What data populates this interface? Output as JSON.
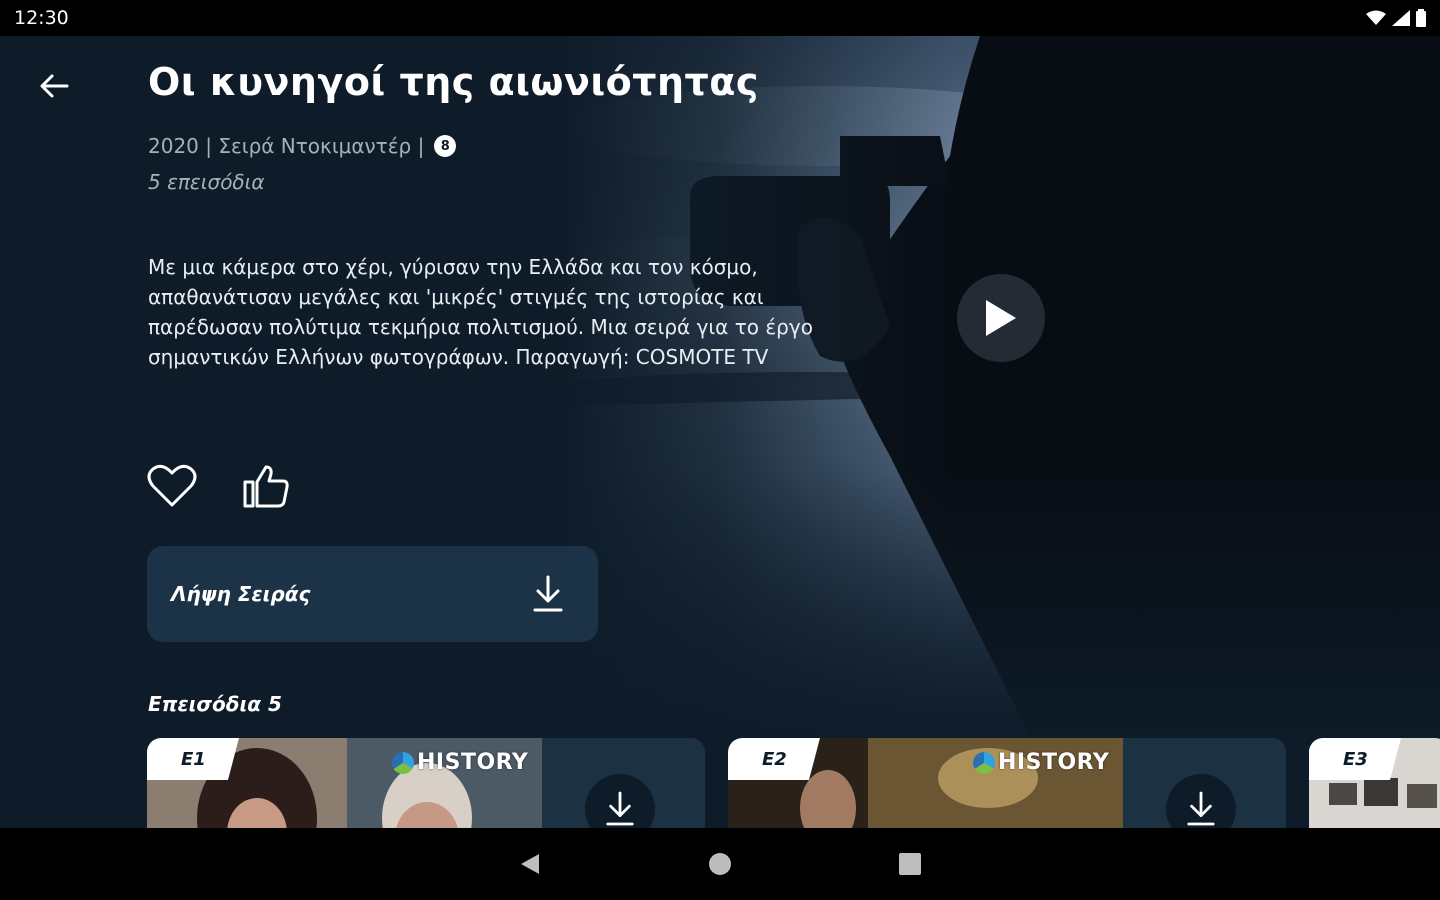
{
  "status_bar": {
    "time": "12:30",
    "icons": [
      "wifi-icon",
      "signal-icon",
      "battery-icon"
    ]
  },
  "header": {
    "back_icon": "arrow-left-icon",
    "title": "Οι κυνηγοί της αιωνιότητας"
  },
  "details": {
    "meta": "2020 | Σειρά Ντοκιμαντέρ |",
    "rating": "8",
    "episodes_count": "5 επεισόδια",
    "description": "Με μια κάμερα στο χέρι, γύρισαν την Ελλάδα και τον κόσμο, απαθανάτισαν μεγάλες και 'μικρές' στιγμές της ιστορίας και παρέδωσαν πολύτιμα τεκμήρια πολιτισμού. Μια σειρά για το έργο σημαντικών Ελλήνων φωτογράφων. Παραγωγή: COSMOTE TV"
  },
  "actions": {
    "favorite_icon": "heart-outline-icon",
    "like_icon": "thumbs-up-icon",
    "download_series_label": "Λήψη Σειράς",
    "download_icon": "download-icon"
  },
  "hero": {
    "play_icon": "play-icon"
  },
  "episodes": {
    "heading": "Επεισόδια 5",
    "items": [
      {
        "tag": "E1",
        "channel": "HISTORY"
      },
      {
        "tag": "E2",
        "channel": "HISTORY"
      },
      {
        "tag": "E3",
        "channel": ""
      }
    ]
  },
  "nav_bar": {
    "buttons": [
      "back-triangle-icon",
      "home-circle-icon",
      "recents-square-icon"
    ]
  },
  "colors": {
    "background": "#0e1c29",
    "card": "#1c3347",
    "status_bar": "#000000",
    "text_secondary": "#a7b0b9"
  }
}
